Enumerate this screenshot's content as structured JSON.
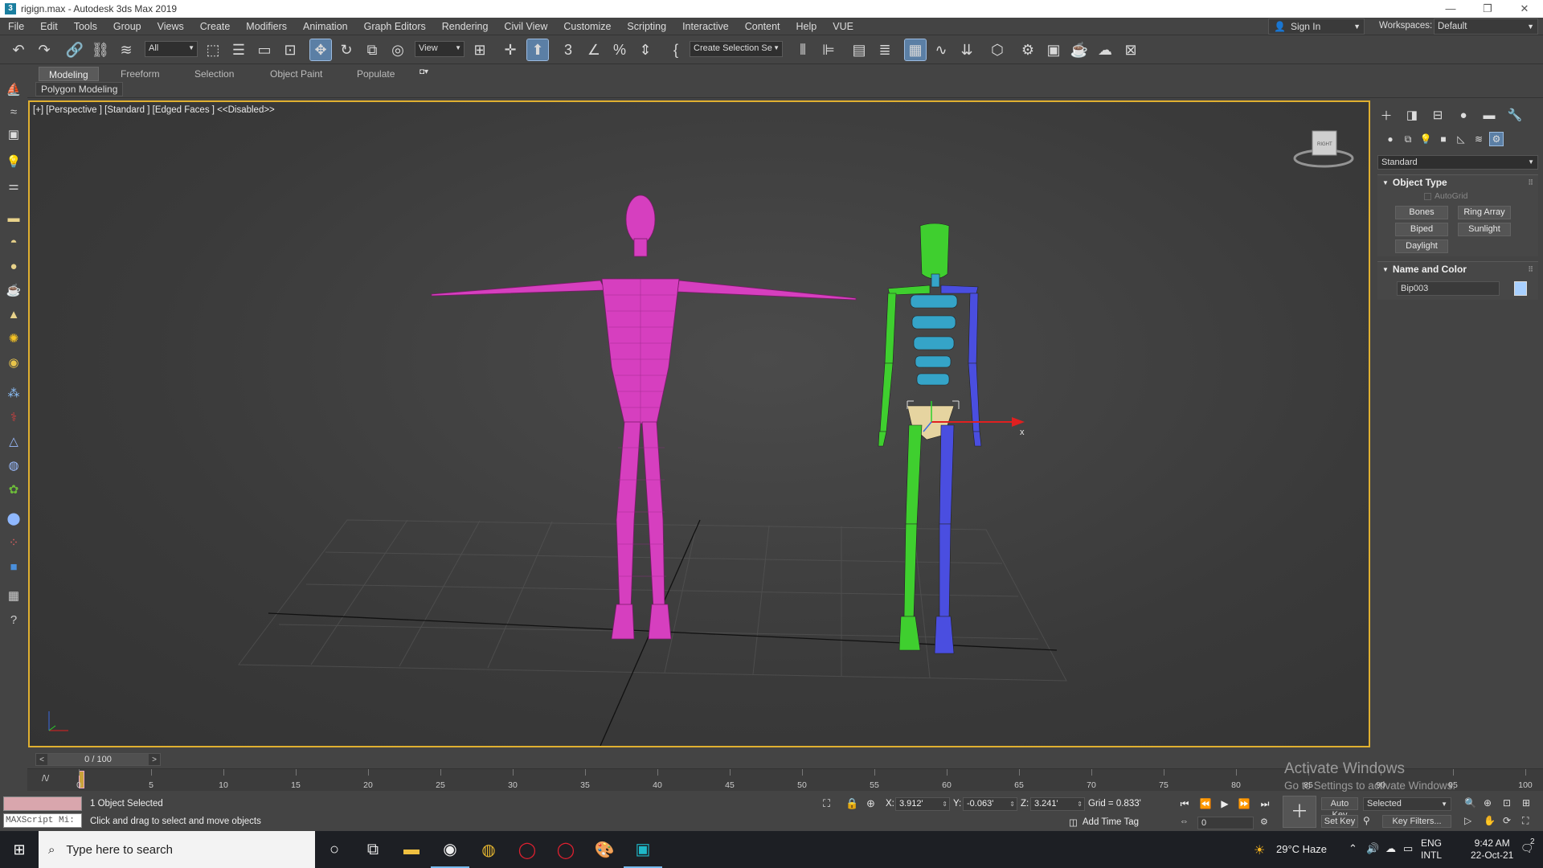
{
  "window": {
    "title": "rigign.max - Autodesk 3ds Max 2019",
    "app_icon": "3",
    "controls": [
      "—",
      "❐",
      "✕"
    ]
  },
  "menubar": {
    "items": [
      "File",
      "Edit",
      "Tools",
      "Group",
      "Views",
      "Create",
      "Modifiers",
      "Animation",
      "Graph Editors",
      "Rendering",
      "Civil View",
      "Customize",
      "Scripting",
      "Interactive",
      "Content",
      "Help",
      "VUE"
    ],
    "sign_in": "Sign In",
    "workspaces_label": "Workspaces:",
    "workspace_value": "Default"
  },
  "toolbar": {
    "selection_filter": "All",
    "ref_coord": "View",
    "named_selection": "Create Selection Se"
  },
  "ribbon": {
    "tabs": [
      "Modeling",
      "Freeform",
      "Selection",
      "Object Paint",
      "Populate"
    ],
    "active_tab": "Modeling",
    "panel": "Polygon Modeling"
  },
  "viewport": {
    "label": "[+] [Perspective ] [Standard ] [Edged Faces ]  <<Disabled>>",
    "viewcube_label": "RIGHT",
    "gizmo_axis": "x",
    "mesh_color": "#d63fbf",
    "biped_left_color": "#3fcf2f",
    "biped_right_color": "#4a4ee0",
    "spine_color": "#35a4c8"
  },
  "command_panel": {
    "category": "Standard",
    "object_type": {
      "title": "Object Type",
      "autogrid": "AutoGrid",
      "buttons": [
        "Bones",
        "Ring Array",
        "Biped",
        "Sunlight",
        "Daylight"
      ]
    },
    "name_and_color": {
      "title": "Name and Color",
      "name": "Bip003",
      "color": "#a8d0ff"
    }
  },
  "timeline": {
    "frame_display": "0 / 100",
    "ticks": [
      "0",
      "5",
      "10",
      "15",
      "20",
      "25",
      "30",
      "35",
      "40",
      "45",
      "50",
      "55",
      "60",
      "65",
      "70",
      "75",
      "80",
      "85",
      "90",
      "95",
      "100"
    ]
  },
  "status": {
    "selection": "1 Object Selected",
    "prompt": "Click and drag to select and move objects",
    "maxscript": "MAXScript Mi:",
    "x_label": "X:",
    "x": "3.912'",
    "y_label": "Y:",
    "y": "-0.063'",
    "z_label": "Z:",
    "z": "3.241'",
    "grid": "Grid = 0.833'",
    "add_time_tag": "Add Time Tag",
    "current_frame": "0",
    "auto_key": "Auto Key",
    "set_key": "Set Key",
    "key_mode": "Selected",
    "key_filters": "Key Filters..."
  },
  "watermark": {
    "line1": "Activate Windows",
    "line2": "Go to Settings to activate Windows."
  },
  "taskbar": {
    "search_placeholder": "Type here to search",
    "weather": "29°C  Haze",
    "lang1": "ENG",
    "lang2": "INTL",
    "time": "9:42 AM",
    "date": "22-Oct-21",
    "notifications": "2"
  }
}
